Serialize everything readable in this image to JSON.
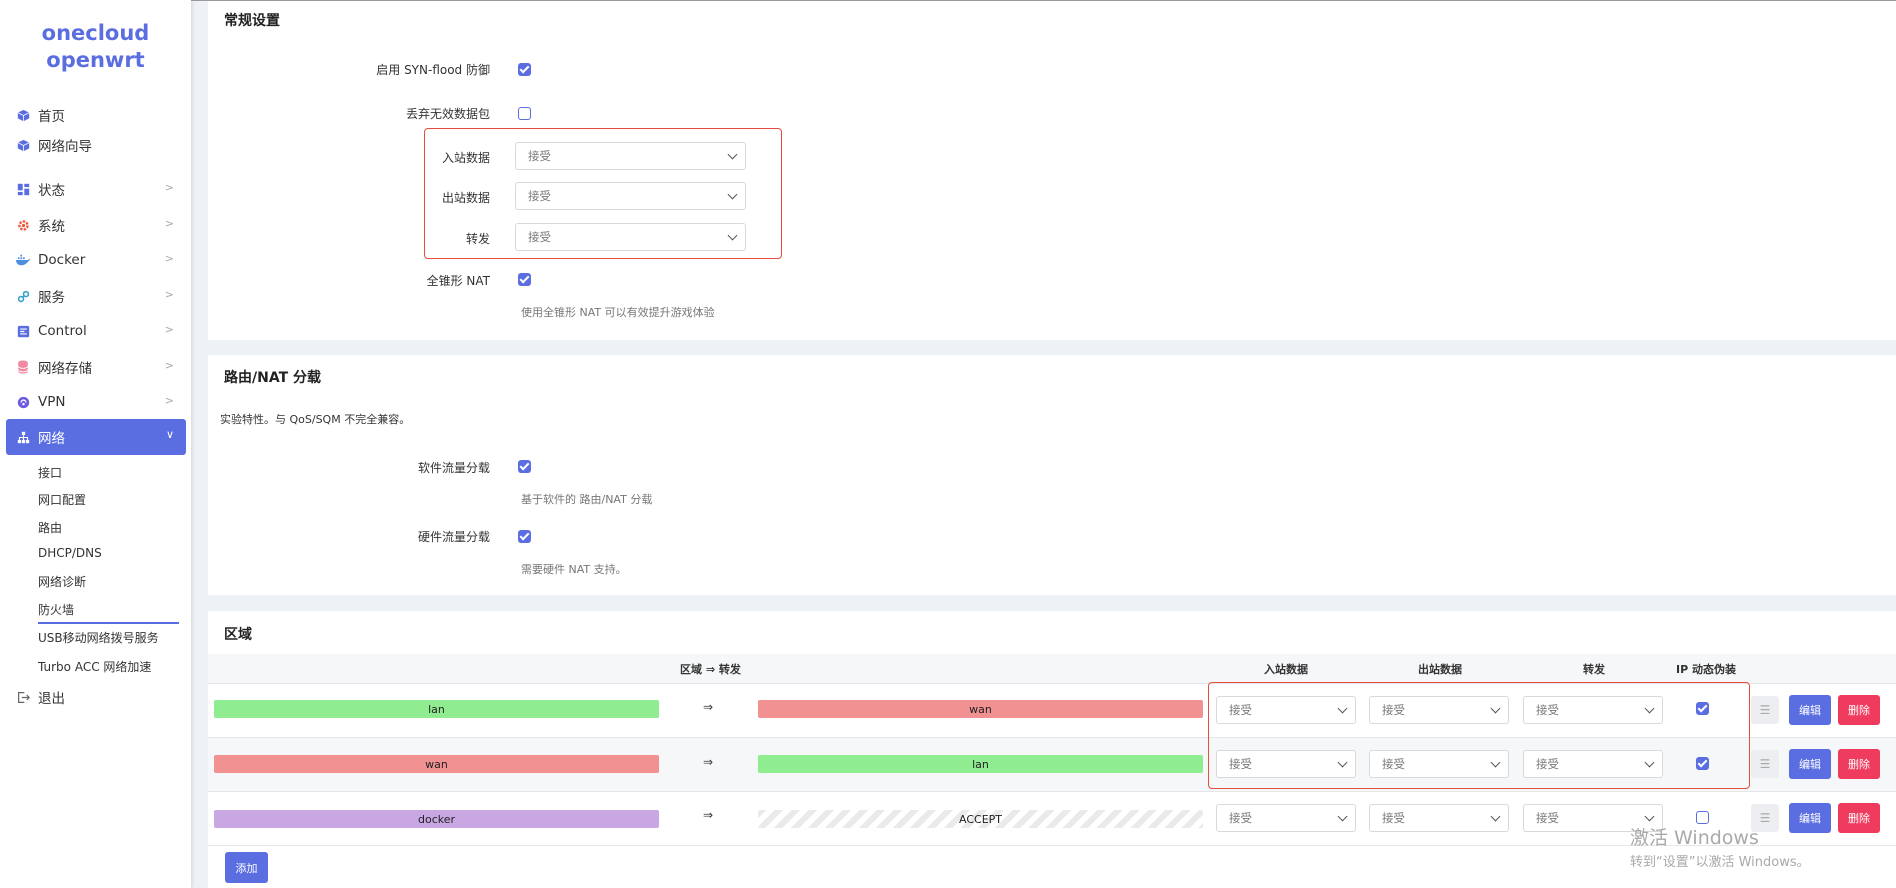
{
  "brand": {
    "line1": "onecloud",
    "line2": "openwrt"
  },
  "sidebar": {
    "items": [
      {
        "label": "首页",
        "icon": "cube-icon",
        "chevron": false
      },
      {
        "label": "网络向导",
        "icon": "cube-icon",
        "chevron": false
      },
      {
        "label": "状态",
        "icon": "dashboard-icon",
        "chevron": true
      },
      {
        "label": "系统",
        "icon": "gear-icon",
        "chevron": true
      },
      {
        "label": "Docker",
        "icon": "docker-icon",
        "chevron": true
      },
      {
        "label": "服务",
        "icon": "link-icon",
        "chevron": true
      },
      {
        "label": "Control",
        "icon": "control-icon",
        "chevron": true
      },
      {
        "label": "网络存储",
        "icon": "database-icon",
        "chevron": true
      },
      {
        "label": "VPN",
        "icon": "vpn-icon",
        "chevron": true
      },
      {
        "label": "网络",
        "icon": "network-icon",
        "chevron": true
      }
    ],
    "sub_items": [
      "接口",
      "网口配置",
      "路由",
      "DHCP/DNS",
      "网络诊断",
      "防火墙",
      "USB移动网络拨号服务",
      "Turbo ACC 网络加速"
    ],
    "logout": "退出"
  },
  "general": {
    "title": "常规设置",
    "syn_flood_label": "启用 SYN-flood 防御",
    "drop_invalid_label": "丢弃无效数据包",
    "input_label": "入站数据",
    "output_label": "出站数据",
    "forward_label": "转发",
    "input_value": "接受",
    "output_value": "接受",
    "forward_value": "接受",
    "fullcone_label": "全锥形 NAT",
    "fullcone_help": "使用全锥形 NAT 可以有效提升游戏体验"
  },
  "offload": {
    "title": "路由/NAT 分载",
    "desc": "实验特性。与 QoS/SQM 不完全兼容。",
    "sw_label": "软件流量分载",
    "sw_help": "基于软件的 路由/NAT 分载",
    "hw_label": "硬件流量分载",
    "hw_help": "需要硬件 NAT 支持。"
  },
  "zones": {
    "title": "区域",
    "headers": {
      "zone_forward": "区域 ⇒ 转发",
      "input": "入站数据",
      "output": "出站数据",
      "forward": "转发",
      "masq": "IP 动态伪装"
    },
    "arrow": "⇒",
    "edit_label": "编辑",
    "delete_label": "删除",
    "add_label": "添加",
    "rows": [
      {
        "zone": "lan",
        "dest": "wan",
        "input": "接受",
        "output": "接受",
        "forward": "接受",
        "masq": true
      },
      {
        "zone": "wan",
        "dest": "lan",
        "input": "接受",
        "output": "接受",
        "forward": "接受",
        "masq": true
      },
      {
        "zone": "docker",
        "dest": "ACCEPT",
        "input": "接受",
        "output": "接受",
        "forward": "接受",
        "masq": false
      }
    ]
  },
  "watermark": {
    "line1": "激活 Windows",
    "line2": "转到“设置”以激活 Windows。"
  },
  "colors": {
    "accent": "#5b6ee1",
    "danger": "#ef3b5d",
    "zone_green": "#90ec90",
    "zone_red": "#f19191",
    "zone_purple": "#c8a7e3"
  }
}
